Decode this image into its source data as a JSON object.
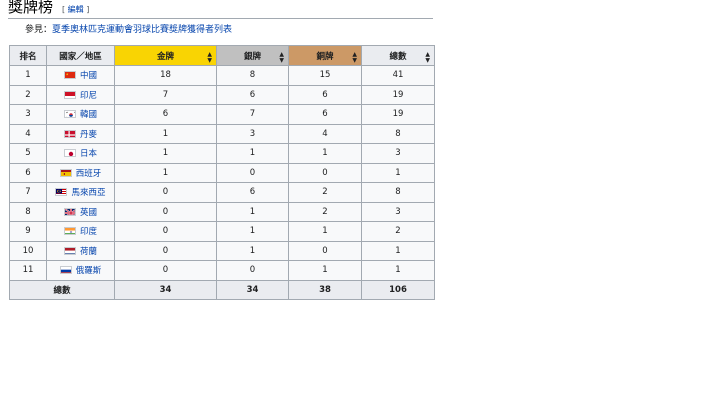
{
  "section": {
    "title": "獎牌榜",
    "edit_label": "編輯",
    "edit_open": "[ ",
    "edit_close": " ]"
  },
  "see_also": {
    "prefix": "參見：",
    "link": "夏季奧林匹克運動會羽球比賽獎牌獲得者列表"
  },
  "table": {
    "headers": {
      "rank": "排名",
      "nation": "國家／地區",
      "gold": "金牌",
      "silver": "銀牌",
      "bronze": "銅牌",
      "total": "總數"
    },
    "sort_icon": "sort-arrows-icon",
    "colors": {
      "gold": "#f9d403",
      "silver": "#c0c0c0",
      "bronze": "#cc9966"
    },
    "rows": [
      {
        "rank": "1",
        "nation": "中國",
        "flag": "china-flag-icon",
        "gold": "18",
        "silver": "8",
        "bronze": "15",
        "total": "41"
      },
      {
        "rank": "2",
        "nation": "印尼",
        "flag": "indonesia-flag-icon",
        "gold": "7",
        "silver": "6",
        "bronze": "6",
        "total": "19"
      },
      {
        "rank": "3",
        "nation": "韓國",
        "flag": "south-korea-flag-icon",
        "gold": "6",
        "silver": "7",
        "bronze": "6",
        "total": "19"
      },
      {
        "rank": "4",
        "nation": "丹麥",
        "flag": "denmark-flag-icon",
        "gold": "1",
        "silver": "3",
        "bronze": "4",
        "total": "8"
      },
      {
        "rank": "5",
        "nation": "日本",
        "flag": "japan-flag-icon",
        "gold": "1",
        "silver": "1",
        "bronze": "1",
        "total": "3"
      },
      {
        "rank": "6",
        "nation": "西班牙",
        "flag": "spain-flag-icon",
        "gold": "1",
        "silver": "0",
        "bronze": "0",
        "total": "1"
      },
      {
        "rank": "7",
        "nation": "馬來西亞",
        "flag": "malaysia-flag-icon",
        "gold": "0",
        "silver": "6",
        "bronze": "2",
        "total": "8"
      },
      {
        "rank": "8",
        "nation": "英國",
        "flag": "uk-flag-icon",
        "gold": "0",
        "silver": "1",
        "bronze": "2",
        "total": "3"
      },
      {
        "rank": "9",
        "nation": "印度",
        "flag": "india-flag-icon",
        "gold": "0",
        "silver": "1",
        "bronze": "1",
        "total": "2"
      },
      {
        "rank": "10",
        "nation": "荷蘭",
        "flag": "netherlands-flag-icon",
        "gold": "0",
        "silver": "1",
        "bronze": "0",
        "total": "1"
      },
      {
        "rank": "11",
        "nation": "俄羅斯",
        "flag": "russia-flag-icon",
        "gold": "0",
        "silver": "0",
        "bronze": "1",
        "total": "1"
      }
    ],
    "totals": {
      "label": "總數",
      "gold": "34",
      "silver": "34",
      "bronze": "38",
      "total": "106"
    }
  }
}
